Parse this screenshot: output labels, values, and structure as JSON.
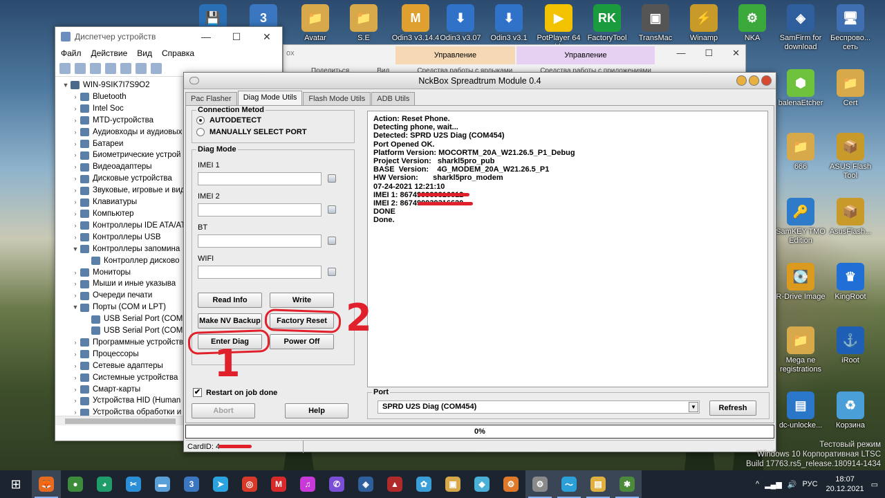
{
  "desktop_icons": [
    {
      "label": "",
      "glyph": "💾",
      "color": "#2a6fb5"
    },
    {
      "label": "",
      "glyph": "3",
      "color": "#3a77c0"
    },
    {
      "label": "Avatar",
      "glyph": "📁",
      "color": "#d8a94a"
    },
    {
      "label": "S.E",
      "glyph": "📁",
      "color": "#d8a94a"
    },
    {
      "label": "Odin3 v3.14.4",
      "glyph": "M",
      "color": "#e0a030"
    },
    {
      "label": "Odin3 v3.07",
      "glyph": "⬇",
      "color": "#2f72c8"
    },
    {
      "label": "Odin3 v3.1",
      "glyph": "⬇",
      "color": "#2f72c8"
    },
    {
      "label": "PotPlayer 64 bit",
      "glyph": "▶",
      "color": "#f2c200"
    },
    {
      "label": "FactoryTool",
      "glyph": "RK",
      "color": "#1a9b3d"
    },
    {
      "label": "TransMac",
      "glyph": "▣",
      "color": "#555555"
    },
    {
      "label": "Winamp",
      "glyph": "⚡",
      "color": "#c79a2a"
    },
    {
      "label": "NKA",
      "glyph": "⚙",
      "color": "#3aa83a"
    },
    {
      "label": "SamFirm for download",
      "glyph": "◈",
      "color": "#2e5f9c"
    },
    {
      "label": "Беспрово... сеть",
      "glyph": "🖥",
      "color": "#3f6fb0"
    },
    {
      "label": "balenaEtcher",
      "glyph": "⬢",
      "color": "#6fc23b"
    },
    {
      "label": "Cert",
      "glyph": "📁",
      "color": "#d8a94a"
    },
    {
      "label": "666",
      "glyph": "📁",
      "color": "#d8a94a"
    },
    {
      "label": "ASUS Flash Tool",
      "glyph": "📦",
      "color": "#c79a2a"
    },
    {
      "label": "SamKEY TMO Edition",
      "glyph": "🔑",
      "color": "#2e7cc9"
    },
    {
      "label": "AsusFlash...",
      "glyph": "📦",
      "color": "#c79a2a"
    },
    {
      "label": "R-Drive Image",
      "glyph": "💽",
      "color": "#d99a1e"
    },
    {
      "label": "KingRoot",
      "glyph": "♛",
      "color": "#1f6fd6"
    },
    {
      "label": "Mega ne registrations",
      "glyph": "📁",
      "color": "#d8a94a"
    },
    {
      "label": "iRoot",
      "glyph": "⚓",
      "color": "#1e5fb5"
    },
    {
      "label": "dc-unlocke...",
      "glyph": "▤",
      "color": "#2a77c9"
    },
    {
      "label": "Корзина",
      "glyph": "♻",
      "color": "#4a9fd8"
    }
  ],
  "devmgr": {
    "title": "Диспетчер устройств",
    "menu": [
      "Файл",
      "Действие",
      "Вид",
      "Справка"
    ],
    "controls": [
      "—",
      "☐",
      "✕"
    ],
    "root": "WIN-9SIK7I7S9O2",
    "items": [
      {
        "label": "Bluetooth",
        "expanded": false,
        "child": false
      },
      {
        "label": "Intel Soc",
        "expanded": false,
        "child": false
      },
      {
        "label": "MTD-устройства",
        "expanded": false,
        "child": false
      },
      {
        "label": "Аудиовходы и аудиовых",
        "expanded": false,
        "child": false
      },
      {
        "label": "Батареи",
        "expanded": false,
        "child": false
      },
      {
        "label": "Биометрические устрой",
        "expanded": false,
        "child": false
      },
      {
        "label": "Видеоадаптеры",
        "expanded": false,
        "child": false
      },
      {
        "label": "Дисковые устройства",
        "expanded": false,
        "child": false
      },
      {
        "label": "Звуковые, игровые и вид",
        "expanded": false,
        "child": false
      },
      {
        "label": "Клавиатуры",
        "expanded": false,
        "child": false
      },
      {
        "label": "Компьютер",
        "expanded": false,
        "child": false
      },
      {
        "label": "Контроллеры IDE ATA/AT",
        "expanded": false,
        "child": false
      },
      {
        "label": "Контроллеры USB",
        "expanded": false,
        "child": false
      },
      {
        "label": "Контроллеры запомина",
        "expanded": true,
        "child": false
      },
      {
        "label": "Контроллер дисково",
        "expanded": false,
        "child": true
      },
      {
        "label": "Мониторы",
        "expanded": false,
        "child": false
      },
      {
        "label": "Мыши и иные указыва",
        "expanded": false,
        "child": false
      },
      {
        "label": "Очереди печати",
        "expanded": false,
        "child": false
      },
      {
        "label": "Порты (COM и LPT)",
        "expanded": true,
        "child": false
      },
      {
        "label": "USB Serial Port (COM8",
        "expanded": false,
        "child": true
      },
      {
        "label": "USB Serial Port (COM9",
        "expanded": false,
        "child": true
      },
      {
        "label": "Программные устройств",
        "expanded": false,
        "child": false
      },
      {
        "label": "Процессоры",
        "expanded": false,
        "child": false
      },
      {
        "label": "Сетевые адаптеры",
        "expanded": false,
        "child": false
      },
      {
        "label": "Системные устройства",
        "expanded": false,
        "child": false
      },
      {
        "label": "Смарт-карты",
        "expanded": false,
        "child": false
      },
      {
        "label": "Устройства HID (Human",
        "expanded": false,
        "child": false
      },
      {
        "label": "Устройства обработки и",
        "expanded": false,
        "child": false
      }
    ]
  },
  "bgwin": {
    "tab_partial": "ox",
    "ribbon1": "Управление",
    "ribbon2": "Управление",
    "row2a": "Поделиться",
    "row2b": "Вид",
    "row2c": "Средства работы с ярлыками",
    "row2d": "Средства работы с приложениями"
  },
  "nck": {
    "title": "NckBox Spreadtrum Module 0.4",
    "tabs": [
      "Pac Flasher",
      "Diag Mode Utils",
      "Flash Mode Utils",
      "ADB Utils"
    ],
    "active_tab": 1,
    "connection": {
      "legend": "Connection Metod",
      "autodetect": "AUTODETECT",
      "manual": "MANUALLY SELECT PORT",
      "selected": "autodetect"
    },
    "diag": {
      "legend": "Diag Mode",
      "fields": [
        {
          "label": "IMEI 1",
          "value": ""
        },
        {
          "label": "IMEI 2",
          "value": ""
        },
        {
          "label": "BT",
          "value": ""
        },
        {
          "label": "WIFI",
          "value": ""
        }
      ],
      "buttons": {
        "read_info": "Read Info",
        "write": "Write",
        "make_nv_backup": "Make NV Backup",
        "factory_reset": "Factory Reset",
        "enter_diag": "Enter Diag",
        "power_off": "Power Off"
      }
    },
    "restart_label": "Restart on job done",
    "restart_checked": true,
    "abort": "Abort",
    "help": "Help",
    "log": [
      "Action: Reset Phone.",
      "Detecting phone, wait...",
      "Detected: SPRD U2S Diag (COM454)",
      "Port Opened OK.",
      "Platform Version: MOCORTM_20A_W21.26.5_P1_Debug",
      "Project Version:   sharkl5pro_pub",
      "BASE  Version:    4G_MODEM_20A_W21.26.5_P1",
      "HW Version:       sharkl5pro_modem",
      "07-24-2021 12:21:10",
      "IMEI 1: 867499939316612",
      "IMEI 2: 867499939316620",
      "DONE",
      "Done."
    ],
    "port": {
      "legend": "Port",
      "value": "SPRD U2S Diag (COM454)",
      "refresh": "Refresh"
    },
    "progress": "0%",
    "progress_fraction": 0,
    "cardid": "CardID: 4"
  },
  "annotations": {
    "enter_diag_num": "1",
    "factory_reset_num": "2",
    "color": "#e0202a"
  },
  "watermark": {
    "line1": "Тестовый режим",
    "line2": "Windows 10 Корпоративная LTSC",
    "line3": "Build 17763.rs5_release.180914-1434"
  },
  "taskbar": {
    "apps": [
      {
        "name": "firefox",
        "glyph": "🦊",
        "color": "#e66a1f",
        "state": "open"
      },
      {
        "name": "chrome",
        "glyph": "●",
        "color": "#3c8c3c",
        "state": ""
      },
      {
        "name": "color-app",
        "glyph": "◕",
        "color": "#1f9c6a",
        "state": ""
      },
      {
        "name": "screenshot",
        "glyph": "✂",
        "color": "#2a8fd6",
        "state": ""
      },
      {
        "name": "explorer-alt",
        "glyph": "▬",
        "color": "#5aa0d8",
        "state": ""
      },
      {
        "name": "3",
        "glyph": "3",
        "color": "#3a77c0",
        "state": ""
      },
      {
        "name": "telegram",
        "glyph": "➤",
        "color": "#2aa3de",
        "state": ""
      },
      {
        "name": "app-red",
        "glyph": "◎",
        "color": "#d83a2a",
        "state": ""
      },
      {
        "name": "mtk",
        "glyph": "M",
        "color": "#d82a2a",
        "state": ""
      },
      {
        "name": "itunes",
        "glyph": "♫",
        "color": "#c83ad8",
        "state": ""
      },
      {
        "name": "viber",
        "glyph": "✆",
        "color": "#7a4fd6",
        "state": ""
      },
      {
        "name": "samfirm",
        "glyph": "◈",
        "color": "#2e5f9c",
        "state": ""
      },
      {
        "name": "gpu",
        "glyph": "▲",
        "color": "#b02a2a",
        "state": ""
      },
      {
        "name": "tool-bird",
        "glyph": "✿",
        "color": "#3a9fd8",
        "state": ""
      },
      {
        "name": "box",
        "glyph": "▣",
        "color": "#d8a94a",
        "state": ""
      },
      {
        "name": "cube",
        "glyph": "◆",
        "color": "#4ab0d8",
        "state": ""
      },
      {
        "name": "android",
        "glyph": "⚙",
        "color": "#e07a2a",
        "state": ""
      },
      {
        "name": "devmgr",
        "glyph": "⚙",
        "color": "#8a8a8a",
        "state": "open"
      },
      {
        "name": "nckbox",
        "glyph": "〜",
        "color": "#2a9fd8",
        "state": "open"
      },
      {
        "name": "folder",
        "glyph": "▤",
        "color": "#e0b040",
        "state": "open"
      },
      {
        "name": "bug",
        "glyph": "✱",
        "color": "#4a8a3a",
        "state": "open"
      }
    ],
    "lang": "РУС",
    "time": "18:07",
    "date": "20.12.2021"
  }
}
